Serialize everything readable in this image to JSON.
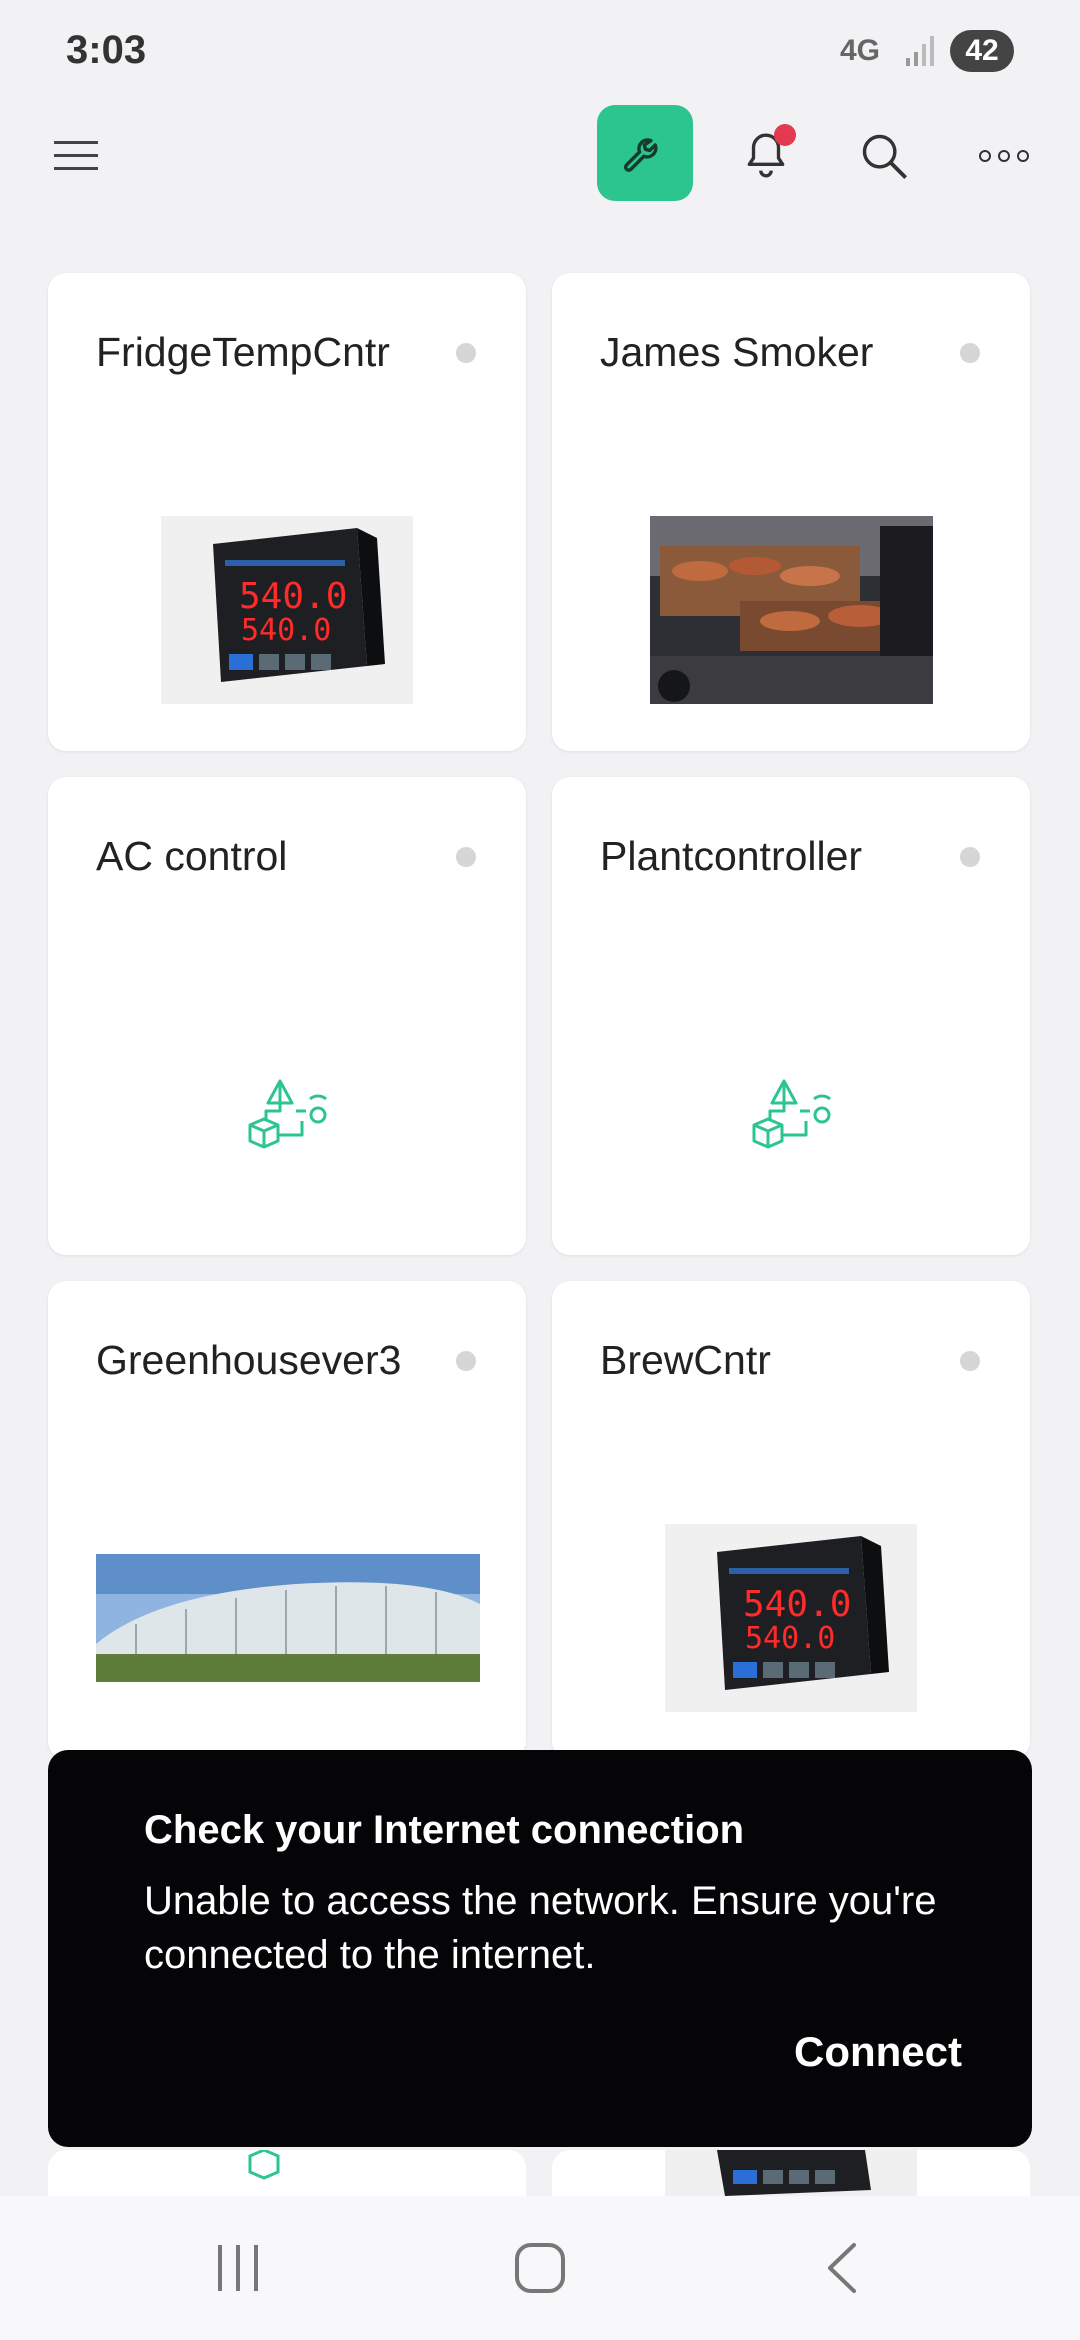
{
  "status_bar": {
    "time": "3:03",
    "network": "4G",
    "battery": "42"
  },
  "app_bar": {
    "accent_color": "#2cc58f",
    "icons": [
      "menu-icon",
      "wrench-icon",
      "bell-icon",
      "search-icon",
      "more-icon"
    ],
    "notification_badge": true
  },
  "devices": [
    {
      "name": "FridgeTempCntr",
      "thumbnail": "temperature-controller-photo",
      "online": false
    },
    {
      "name": "James Smoker",
      "thumbnail": "smoker-grill-photo",
      "online": false
    },
    {
      "name": "AC control",
      "thumbnail": "iot-device-icon",
      "online": false
    },
    {
      "name": "Plantcontroller",
      "thumbnail": "iot-device-icon",
      "online": false
    },
    {
      "name": "Greenhousever3",
      "thumbnail": "greenhouse-photo",
      "online": false
    },
    {
      "name": "BrewCntr",
      "thumbnail": "temperature-controller-photo",
      "online": false
    }
  ],
  "snackbar": {
    "title": "Check your Internet connection",
    "message": "Unable to access the network. Ensure you're connected to the internet.",
    "action": "Connect"
  },
  "nav_bar": {
    "buttons": [
      "recents-icon",
      "home-icon",
      "back-icon"
    ]
  }
}
